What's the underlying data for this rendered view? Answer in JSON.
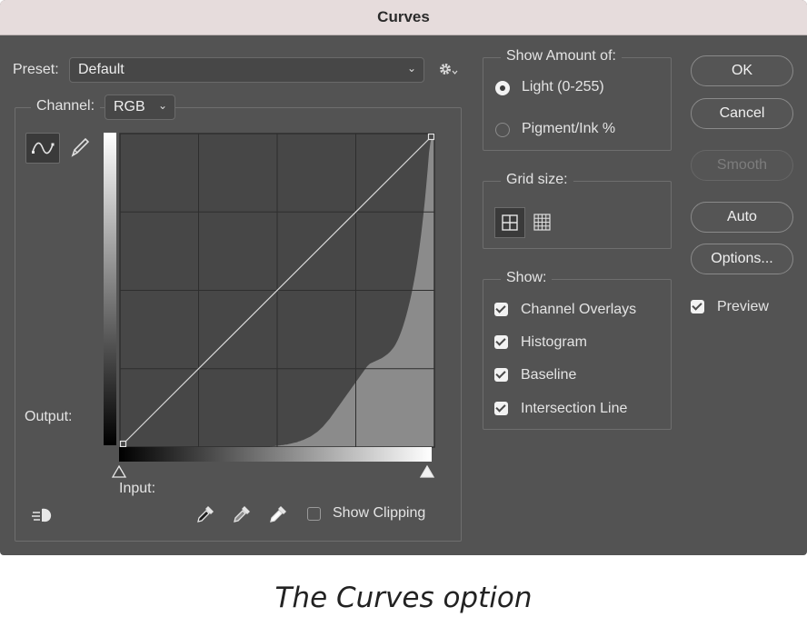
{
  "dialog": {
    "title": "Curves"
  },
  "preset": {
    "label": "Preset:",
    "value": "Default",
    "icons": [
      "chevron-down-icon",
      "gear-icon"
    ]
  },
  "channel": {
    "label": "Channel:",
    "value": "RGB"
  },
  "graph": {
    "output_label": "Output:",
    "input_label": "Input:",
    "point_tool": "curve-icon",
    "pencil_tool": "pencil-icon",
    "histogram_color": "#8b8b8b",
    "plot_bg": "#474747",
    "histogram": [
      0,
      0,
      0,
      0,
      0,
      0,
      0,
      0,
      0,
      0,
      0,
      0,
      0,
      0,
      0,
      0,
      0,
      0,
      0,
      0,
      0,
      0,
      0,
      0,
      0,
      0,
      0,
      0,
      0,
      0,
      0,
      0,
      0,
      0,
      0,
      0,
      0,
      0,
      0,
      0,
      0,
      0,
      0,
      0,
      0,
      0,
      0,
      0,
      0,
      0,
      0,
      0,
      0,
      0,
      0,
      0,
      0,
      0,
      0,
      0,
      0,
      0,
      0,
      0,
      0,
      0,
      0,
      0,
      0,
      0,
      0,
      0,
      0,
      0,
      0,
      0,
      0,
      0,
      0,
      0,
      0,
      0,
      0,
      0,
      0,
      0,
      0,
      0,
      0,
      0,
      0,
      0,
      0,
      0,
      0,
      0,
      0,
      0,
      0,
      0,
      0,
      0,
      0,
      0,
      0,
      0,
      0,
      0,
      0,
      0,
      0.001,
      0.001,
      0.002,
      0.002,
      0.003,
      0.003,
      0.004,
      0.004,
      0.005,
      0.005,
      0.006,
      0.006,
      0.007,
      0.008,
      0.008,
      0.009,
      0.01,
      0.011,
      0.012,
      0.013,
      0.014,
      0.015,
      0.016,
      0.018,
      0.019,
      0.021,
      0.022,
      0.024,
      0.026,
      0.028,
      0.03,
      0.032,
      0.034,
      0.037,
      0.04,
      0.043,
      0.046,
      0.049,
      0.053,
      0.057,
      0.061,
      0.065,
      0.07,
      0.075,
      0.08,
      0.085,
      0.09,
      0.096,
      0.102,
      0.108,
      0.114,
      0.12,
      0.126,
      0.132,
      0.138,
      0.144,
      0.15,
      0.156,
      0.162,
      0.168,
      0.174,
      0.18,
      0.186,
      0.192,
      0.198,
      0.204,
      0.21,
      0.216,
      0.222,
      0.228,
      0.234,
      0.24,
      0.246,
      0.252,
      0.258,
      0.262,
      0.266,
      0.268,
      0.27,
      0.272,
      0.274,
      0.276,
      0.278,
      0.28,
      0.282,
      0.284,
      0.287,
      0.29,
      0.293,
      0.296,
      0.3,
      0.304,
      0.309,
      0.314,
      0.32,
      0.327,
      0.335,
      0.344,
      0.354,
      0.365,
      0.377,
      0.39,
      0.404,
      0.419,
      0.435,
      0.452,
      0.47,
      0.49,
      0.511,
      0.533,
      0.557,
      0.583,
      0.611,
      0.641,
      0.674,
      0.71,
      0.749,
      0.791,
      0.837,
      0.886,
      0.939,
      0.97,
      0.99,
      1.0,
      1.0
    ]
  },
  "clipping": {
    "label": "Show Clipping",
    "checked": false,
    "eyedroppers": [
      "black-point-eyedropper-icon",
      "gray-point-eyedropper-icon",
      "white-point-eyedropper-icon"
    ],
    "target_tool": "target-adjust-icon"
  },
  "show_amount": {
    "title": "Show Amount of:",
    "light": "Light  (0-255)",
    "pigment": "Pigment/Ink %",
    "selected": "light"
  },
  "grid_size": {
    "title": "Grid size:",
    "icons": [
      "grid-4x4-icon",
      "grid-10x10-icon"
    ],
    "selected": "grid-4x4-icon"
  },
  "show": {
    "title": "Show:",
    "items": [
      {
        "label": "Channel Overlays",
        "checked": true
      },
      {
        "label": "Histogram",
        "checked": true
      },
      {
        "label": "Baseline",
        "checked": true
      },
      {
        "label": "Intersection Line",
        "checked": true
      }
    ]
  },
  "buttons": {
    "ok": "OK",
    "cancel": "Cancel",
    "smooth": "Smooth",
    "auto": "Auto",
    "options": "Options..."
  },
  "preview": {
    "label": "Preview",
    "checked": true
  },
  "caption": "The Curves option"
}
